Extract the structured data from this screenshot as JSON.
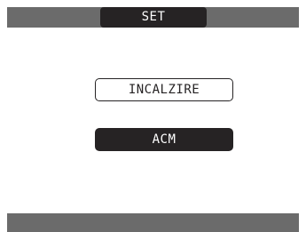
{
  "header": {
    "title": "SET"
  },
  "menu": {
    "options": [
      {
        "label": "INCALZIRE",
        "selected": false
      },
      {
        "label": "ACM",
        "selected": true
      }
    ]
  },
  "colors": {
    "bar": "#6b6b6b",
    "dark": "#262324",
    "background": "#ffffff"
  }
}
